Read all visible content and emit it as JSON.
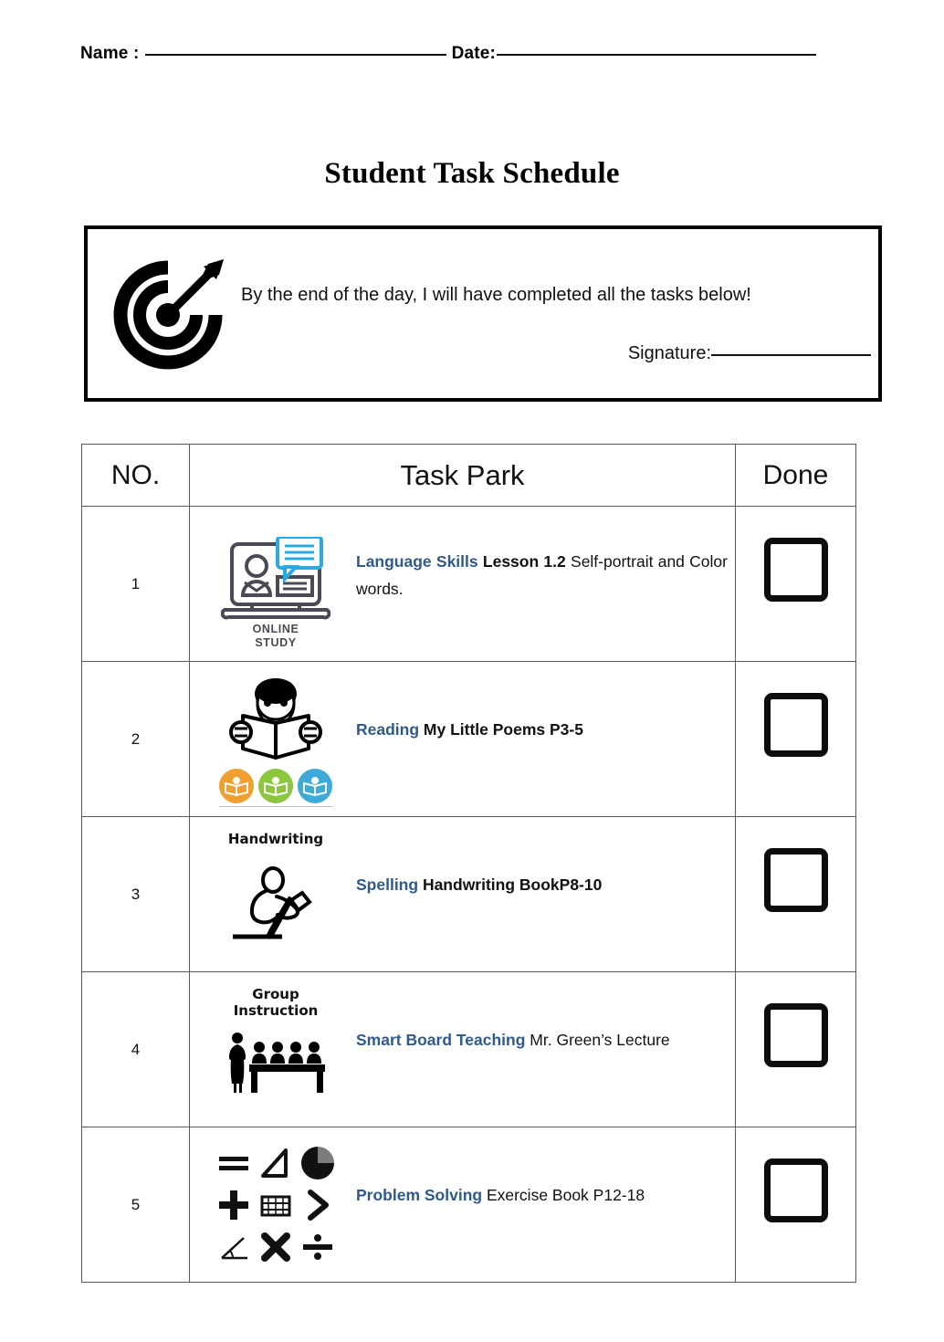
{
  "header": {
    "name_label": "Name :",
    "date_label": "Date:"
  },
  "title": "Student Task Schedule",
  "pledge": {
    "icon": "target-icon",
    "text": "By the end of the day, I will have completed all the tasks below!",
    "signature_label": "Signature:"
  },
  "table": {
    "headers": {
      "no": "NO.",
      "task": "Task Park",
      "done": "Done"
    },
    "rows": [
      {
        "no": "1",
        "icon": "online-study-icon",
        "icon_caption_line1": "ONLINE",
        "icon_caption_line2": "STUDY",
        "subject": "Language Skills",
        "detail_bold": "Lesson 1.2",
        "detail": "Self-portrait and Color words.",
        "done": ""
      },
      {
        "no": "2",
        "icon": "reading-child-icon",
        "subject": "Reading",
        "detail_bold": "My Little Poems P3-5",
        "detail": "",
        "done": ""
      },
      {
        "no": "3",
        "icon": "handwriting-icon",
        "icon_label": "Handwriting",
        "subject": "Spelling",
        "detail_bold": "Handwriting BookP8-10",
        "detail": "",
        "done": ""
      },
      {
        "no": "4",
        "icon": "group-instruction-icon",
        "icon_label_line1": "Group",
        "icon_label_line2": "Instruction",
        "subject": "Smart Board Teaching",
        "detail_bold": "",
        "detail": "Mr. Green’s Lecture",
        "done": ""
      },
      {
        "no": "5",
        "icon": "math-symbols-icon",
        "subject": "Problem Solving",
        "detail_bold": "",
        "detail": "Exercise Book P12-18",
        "done": ""
      }
    ]
  },
  "colors": {
    "subject_blue": "#2f5a8b",
    "icon_gray": "#4a4a55",
    "icon_cyan": "#29abe2",
    "badge_orange": "#f0a030",
    "badge_green": "#8cc63f",
    "badge_blue": "#3fa9d8",
    "border": "#5a5a5a",
    "text": "#111111"
  }
}
